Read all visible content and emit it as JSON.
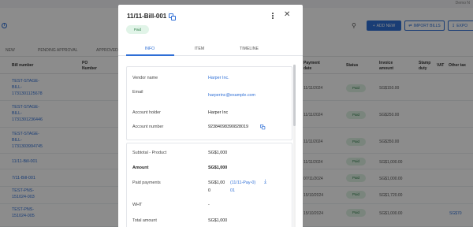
{
  "topbar": {
    "user": "Demo N"
  },
  "toolbar": {
    "add_new": "ADD NEW",
    "import_bills": "IMPORT BILLS",
    "export": "EXPO"
  },
  "bg_tabs": [
    "NEW",
    "PENDING APPROVAL",
    "APPROVED"
  ],
  "columns": {
    "bill_number": "Bill number",
    "po_number": "PO Number",
    "payment_date": "Payment date",
    "status": "Status",
    "invoice_amount": "Invoice amount",
    "stamp_duty": "Stamp duty",
    "vat": "VAT",
    "other_tax": "Other tax"
  },
  "rows": [
    {
      "bill": "TEST-STAGE-BILL-1731301125678",
      "date": "11/11/2024",
      "status": "Paid",
      "amount": "SG$150.00",
      "tax": ""
    },
    {
      "bill": "TEST-STAGE-BILL-1731301236446",
      "date": "11/11/2024",
      "status": "Paid",
      "amount": "SG$250.00",
      "tax": ""
    },
    {
      "bill": "TEST-STAGE-BILL-1731303994745",
      "date": "11/11/2024",
      "status": "Paid",
      "amount": "SG$350.00",
      "tax": ""
    },
    {
      "bill": "11/11-Bill-001",
      "date": "11/11/2024",
      "status": "Paid",
      "amount": "SG$1,000.00",
      "tax": ""
    },
    {
      "bill": "7/11-Bill-001",
      "date": "07/11/2024",
      "status": "Paid",
      "amount": "SG$1,000.00",
      "tax": ""
    },
    {
      "bill": "TEST-PNS-151024-003",
      "date": "15/10/2024",
      "status": "Paid",
      "amount": "SG$1,720.00",
      "tax": ""
    },
    {
      "bill": "TEST-PNS-151024-005",
      "date": "15/10/2024",
      "status": "Paid",
      "amount": "SG$1,000.00",
      "tax": "SG$70"
    }
  ],
  "modal": {
    "title": "11/11-Bill-001",
    "status": "Paid",
    "tabs": [
      "INFO",
      "ITEM",
      "TIMELINE"
    ],
    "vendor_label": "Vendor name",
    "vendor_value": "Harper Inc.",
    "email_label": "Email",
    "email_value": "harperinc@example.com",
    "holder_label": "Account holder",
    "holder_value": "Harper Inc",
    "accnum_label": "Account number",
    "accnum_value": "923840983908280​19",
    "subtotal_label": "Subtotal - Product",
    "subtotal_value": "SG$1,000",
    "amount_label": "Amount",
    "amount_value": "SG$1,000",
    "paid_label": "Paid payments",
    "paid_value_1": "SG$1,00",
    "paid_value_2": "0",
    "paid_ref_1": "(11/11-Pay-0)",
    "paid_ref_2": "01",
    "wht_label": "WHT",
    "wht_value": "-",
    "total_label": "Total amount",
    "total_value": "SG$1,000"
  }
}
